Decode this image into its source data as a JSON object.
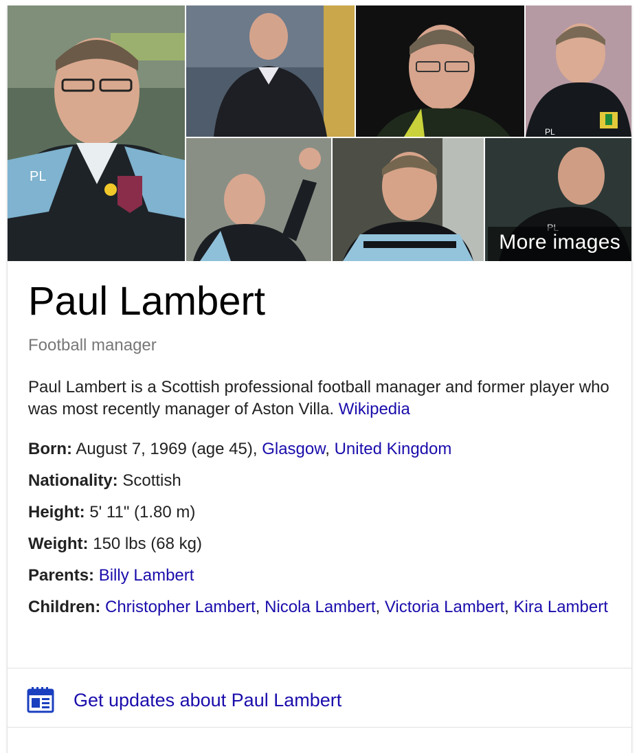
{
  "gallery": {
    "more_images_label": "More images"
  },
  "entity": {
    "name": "Paul Lambert",
    "type": "Football manager",
    "description": "Paul Lambert is a Scottish professional football manager and former player who was most recently manager of Aston Villa.",
    "source_link": "Wikipedia"
  },
  "facts": {
    "born": {
      "label": "Born:",
      "text": "August 7, 1969 (age 45),",
      "link1": "Glasgow",
      "sep": ",",
      "link2": "United Kingdom"
    },
    "nationality": {
      "label": "Nationality:",
      "text": "Scottish"
    },
    "height": {
      "label": "Height:",
      "text": "5' 11\" (1.80 m)"
    },
    "weight": {
      "label": "Weight:",
      "text": "150 lbs (68 kg)"
    },
    "parents": {
      "label": "Parents:",
      "link1": "Billy Lambert"
    },
    "children": {
      "label": "Children:",
      "link1": "Christopher Lambert",
      "link2": "Nicola Lambert",
      "link3": "Victoria Lambert",
      "link4": "Kira Lambert",
      "sep": ","
    }
  },
  "updates": {
    "label": "Get updates about Paul Lambert",
    "icon": "newspaper-icon"
  },
  "colors": {
    "link": "#1a0dab",
    "subtitle": "#777777",
    "text": "#222222"
  }
}
